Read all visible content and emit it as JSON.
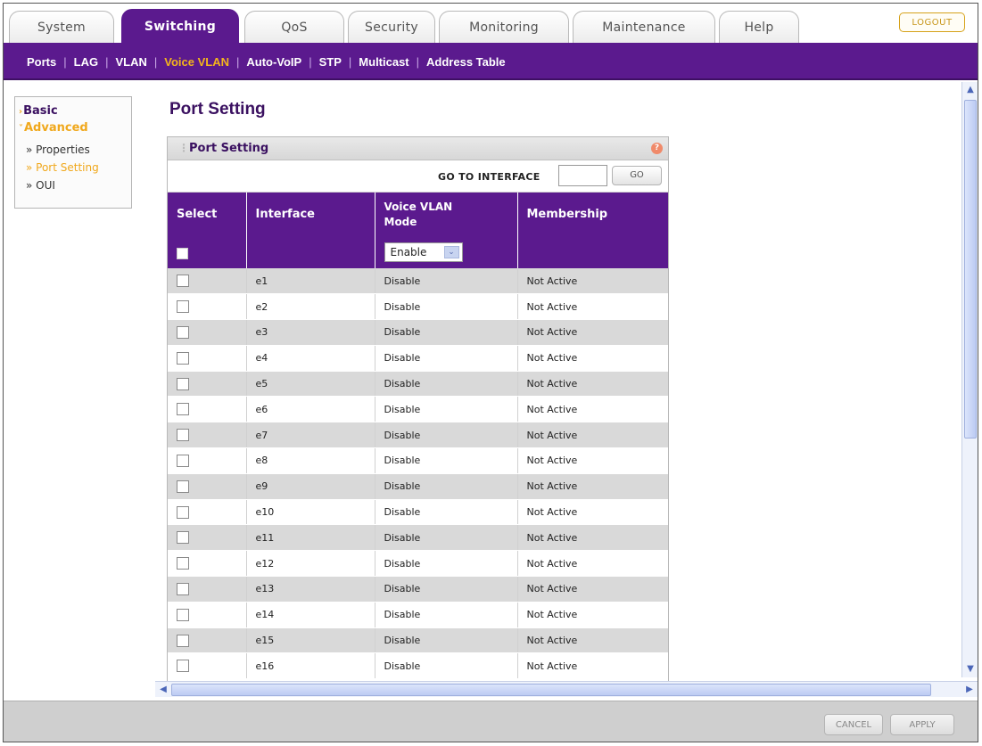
{
  "tabs": [
    "System",
    "Switching",
    "QoS",
    "Security",
    "Monitoring",
    "Maintenance",
    "Help"
  ],
  "active_tab": "Switching",
  "logout_label": "LOGOUT",
  "subnav": {
    "items": [
      "Ports",
      "LAG",
      "VLAN",
      "Voice VLAN",
      "Auto-VoIP",
      "STP",
      "Multicast",
      "Address Table"
    ],
    "active": "Voice VLAN"
  },
  "sidebar": {
    "basic": "Basic",
    "advanced": "Advanced",
    "items": [
      "Properties",
      "Port Setting",
      "OUI"
    ],
    "active": "Port Setting"
  },
  "page_title": "Port Setting",
  "panel": {
    "title": "Port Setting",
    "goto_label": "GO TO INTERFACE",
    "goto_value": "",
    "go_button": "GO"
  },
  "table": {
    "headers": {
      "select": "Select",
      "interface": "Interface",
      "mode_line1": "Voice VLAN",
      "mode_line2": "Mode",
      "membership": "Membership"
    },
    "mode_select_value": "Enable",
    "rows": [
      {
        "interface": "e1",
        "mode": "Disable",
        "membership": "Not Active"
      },
      {
        "interface": "e2",
        "mode": "Disable",
        "membership": "Not Active"
      },
      {
        "interface": "e3",
        "mode": "Disable",
        "membership": "Not Active"
      },
      {
        "interface": "e4",
        "mode": "Disable",
        "membership": "Not Active"
      },
      {
        "interface": "e5",
        "mode": "Disable",
        "membership": "Not Active"
      },
      {
        "interface": "e6",
        "mode": "Disable",
        "membership": "Not Active"
      },
      {
        "interface": "e7",
        "mode": "Disable",
        "membership": "Not Active"
      },
      {
        "interface": "e8",
        "mode": "Disable",
        "membership": "Not Active"
      },
      {
        "interface": "e9",
        "mode": "Disable",
        "membership": "Not Active"
      },
      {
        "interface": "e10",
        "mode": "Disable",
        "membership": "Not Active"
      },
      {
        "interface": "e11",
        "mode": "Disable",
        "membership": "Not Active"
      },
      {
        "interface": "e12",
        "mode": "Disable",
        "membership": "Not Active"
      },
      {
        "interface": "e13",
        "mode": "Disable",
        "membership": "Not Active"
      },
      {
        "interface": "e14",
        "mode": "Disable",
        "membership": "Not Active"
      },
      {
        "interface": "e15",
        "mode": "Disable",
        "membership": "Not Active"
      },
      {
        "interface": "e16",
        "mode": "Disable",
        "membership": "Not Active"
      }
    ]
  },
  "buttons": {
    "cancel": "CANCEL",
    "apply": "APPLY"
  },
  "colors": {
    "brand": "#5b1a8e",
    "accent": "#f0a81c",
    "row_alt": "#d9d9d9"
  }
}
